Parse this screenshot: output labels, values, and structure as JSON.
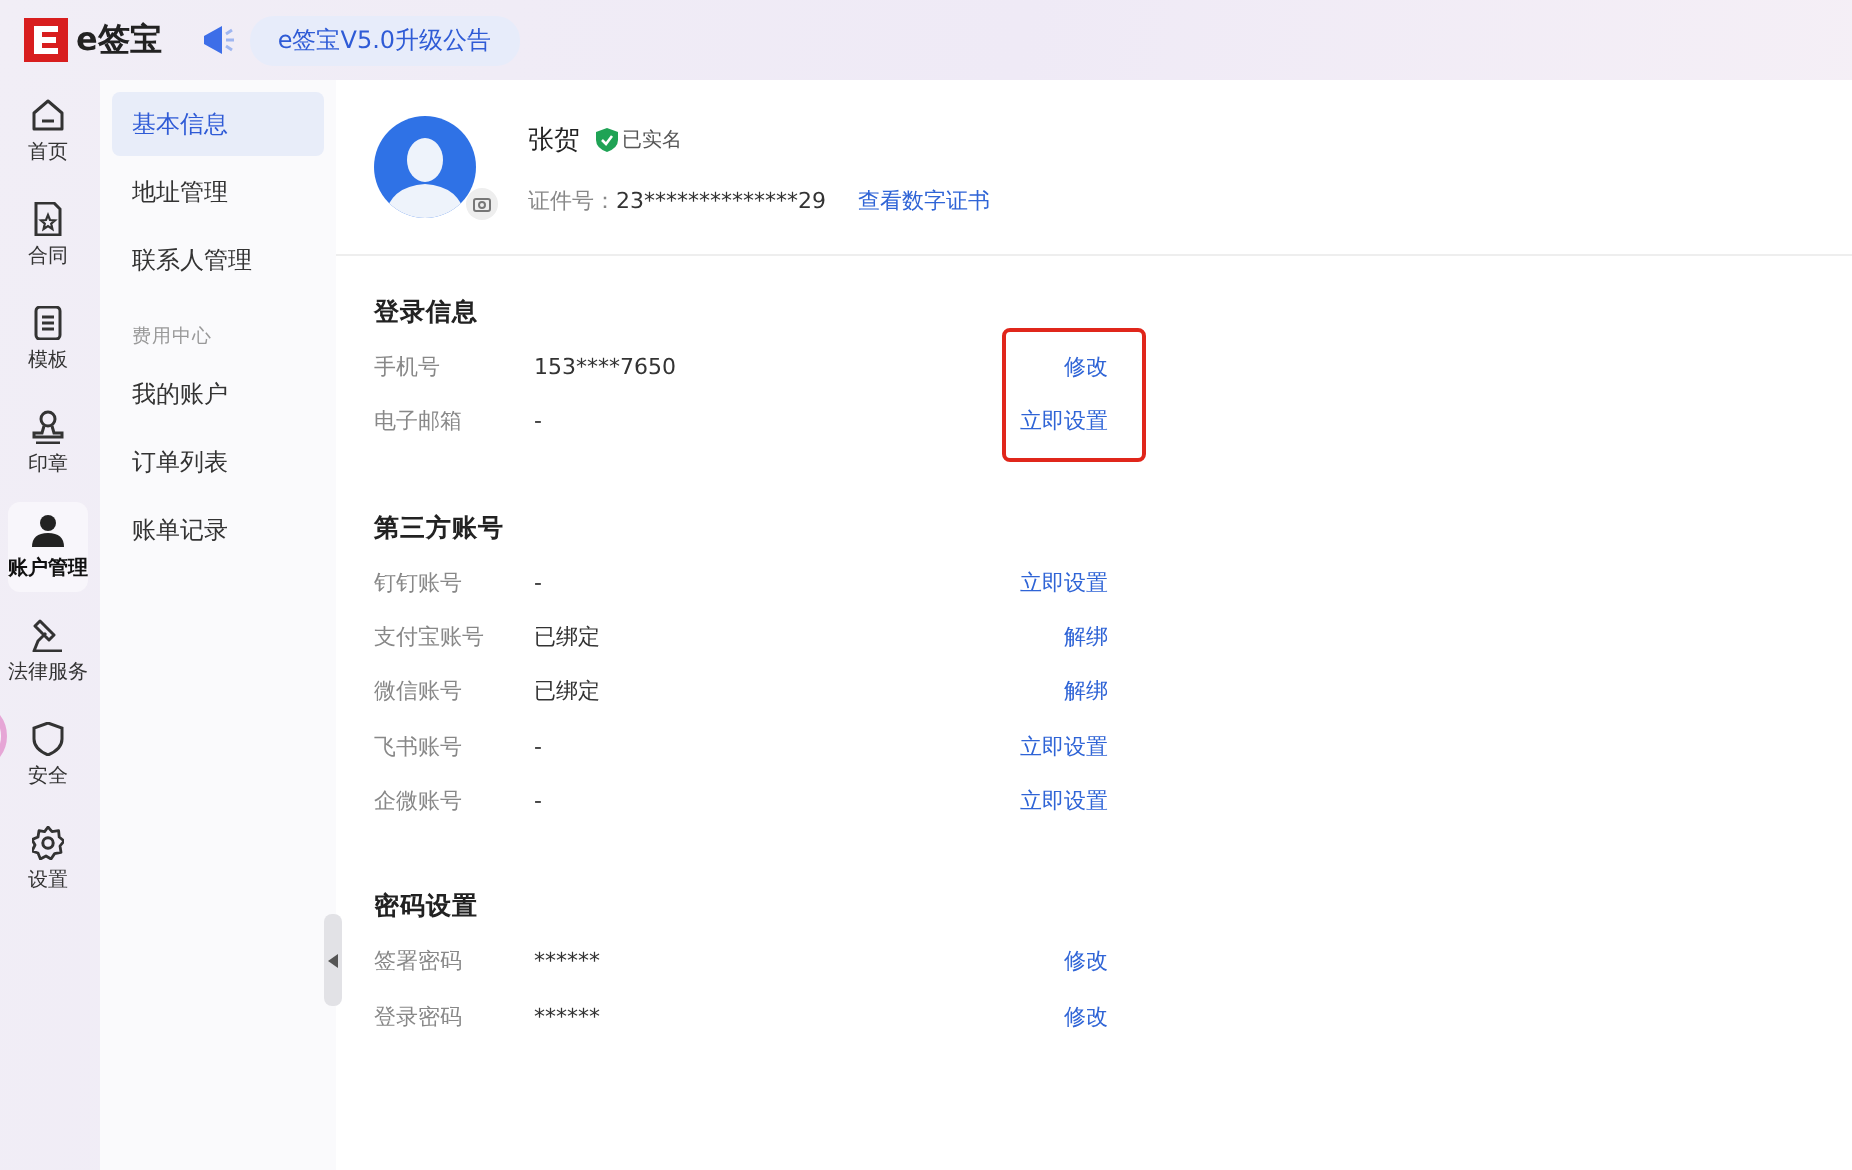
{
  "header": {
    "logo_text": "e签宝",
    "announcement": "e签宝V5.0升级公告"
  },
  "nav": [
    {
      "label": "首页",
      "selected": false
    },
    {
      "label": "合同",
      "selected": false
    },
    {
      "label": "模板",
      "selected": false
    },
    {
      "label": "印章",
      "selected": false
    },
    {
      "label": "账户管理",
      "selected": true
    },
    {
      "label": "法律服务",
      "selected": false
    },
    {
      "label": "安全",
      "selected": false
    },
    {
      "label": "设置",
      "selected": false
    }
  ],
  "submenu": [
    {
      "kind": "item",
      "label": "基本信息",
      "selected": true
    },
    {
      "kind": "item",
      "label": "地址管理",
      "selected": false
    },
    {
      "kind": "item",
      "label": "联系人管理",
      "selected": false
    },
    {
      "kind": "heading",
      "label": "费用中心"
    },
    {
      "kind": "item",
      "label": "我的账户",
      "selected": false
    },
    {
      "kind": "item",
      "label": "订单列表",
      "selected": false
    },
    {
      "kind": "item",
      "label": "账单记录",
      "selected": false
    }
  ],
  "profile": {
    "name": "张贺",
    "verified_label": "已实名",
    "id_label": "证件号：",
    "id_value": "23**************29",
    "certificate_link": "查看数字证书"
  },
  "sections": [
    {
      "title": "登录信息",
      "highlighted": true,
      "rows": [
        {
          "label": "手机号",
          "value": "153****7650",
          "action": "修改"
        },
        {
          "label": "电子邮箱",
          "value": "-",
          "action": "立即设置"
        }
      ]
    },
    {
      "title": "第三方账号",
      "highlighted": false,
      "rows": [
        {
          "label": "钉钉账号",
          "value": "-",
          "action": "立即设置"
        },
        {
          "label": "支付宝账号",
          "value": "已绑定",
          "action": "解绑"
        },
        {
          "label": "微信账号",
          "value": "已绑定",
          "action": "解绑"
        },
        {
          "label": "飞书账号",
          "value": "-",
          "action": "立即设置"
        },
        {
          "label": "企微账号",
          "value": "-",
          "action": "立即设置"
        }
      ]
    },
    {
      "title": "密码设置",
      "highlighted": false,
      "rows": [
        {
          "label": "签署密码",
          "value": "******",
          "action": "修改"
        },
        {
          "label": "登录密码",
          "value": "******",
          "action": "修改"
        }
      ]
    }
  ]
}
